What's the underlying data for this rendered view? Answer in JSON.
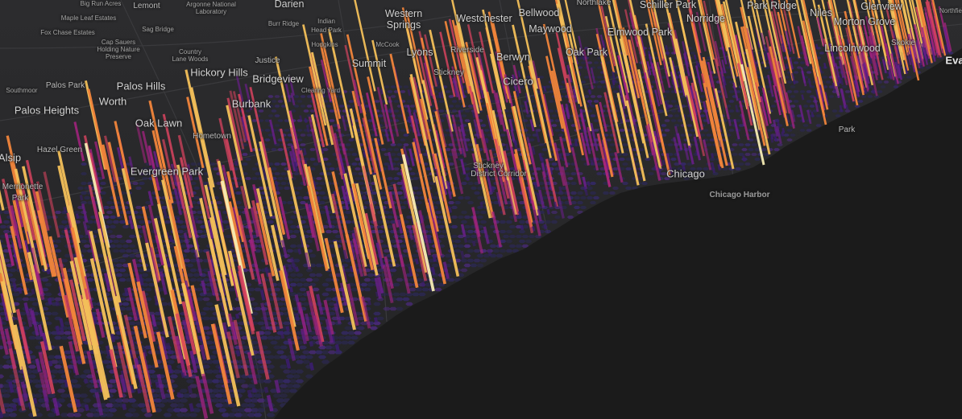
{
  "map": {
    "colors": {
      "land": "#2a2a2c",
      "lake": "#1b1b1b",
      "hex_base": "#2b2850",
      "column_ramp": [
        "#3b1d6e",
        "#6a1f8a",
        "#a3237f",
        "#d8435f",
        "#f2853b",
        "#f4c05a",
        "#f6ecb4"
      ]
    },
    "labels": [
      {
        "text": "Big Run Acres",
        "size": "small"
      },
      {
        "text": "Lemont",
        "size": "med"
      },
      {
        "text": "Argonne National",
        "size": "small"
      },
      {
        "text": "Laboratory",
        "size": "small"
      },
      {
        "text": "Darien",
        "size": "large"
      },
      {
        "text": "Western",
        "size": "large"
      },
      {
        "text": "Springs",
        "size": "large"
      },
      {
        "text": "Westchester",
        "size": "large"
      },
      {
        "text": "Bellwood",
        "size": "large"
      },
      {
        "text": "Northlake",
        "size": "med"
      },
      {
        "text": "Schiller Park",
        "size": "large"
      },
      {
        "text": "Park Ridge",
        "size": "large"
      },
      {
        "text": "Niles",
        "size": "large"
      },
      {
        "text": "Glenview",
        "size": "large"
      },
      {
        "text": "Northfie",
        "size": "small"
      },
      {
        "text": "Maple Leaf Estates",
        "size": "small"
      },
      {
        "text": "Burr Ridge",
        "size": "small"
      },
      {
        "text": "Indian",
        "size": "small"
      },
      {
        "text": "Head Park",
        "size": "small"
      },
      {
        "text": "Maywood",
        "size": "large"
      },
      {
        "text": "Elmwood Park",
        "size": "large"
      },
      {
        "text": "Norridge",
        "size": "large"
      },
      {
        "text": "Morton Grove",
        "size": "large"
      },
      {
        "text": "Fox Chase Estates",
        "size": "small"
      },
      {
        "text": "Sag Bridge",
        "size": "small"
      },
      {
        "text": "Hodgkins",
        "size": "small"
      },
      {
        "text": "McCook",
        "size": "small"
      },
      {
        "text": "Cap Sauers",
        "size": "small"
      },
      {
        "text": "Holding Nature",
        "size": "small"
      },
      {
        "text": "Preserve",
        "size": "small"
      },
      {
        "text": "Country",
        "size": "small"
      },
      {
        "text": "Lane Woods",
        "size": "small"
      },
      {
        "text": "Lyons",
        "size": "large"
      },
      {
        "text": "Riverside",
        "size": "med"
      },
      {
        "text": "Berwyn",
        "size": "large"
      },
      {
        "text": "Oak Park",
        "size": "large"
      },
      {
        "text": "Lincolnwood",
        "size": "large"
      },
      {
        "text": "Skokie",
        "size": "med"
      },
      {
        "text": "Eva",
        "size": "bright"
      },
      {
        "text": "Justice",
        "size": "med"
      },
      {
        "text": "Summit",
        "size": "large"
      },
      {
        "text": "Hickory Hills",
        "size": "xl"
      },
      {
        "text": "Stickney",
        "size": "med"
      },
      {
        "text": "Cicero",
        "size": "xl"
      },
      {
        "text": "Palos Park",
        "size": "med"
      },
      {
        "text": "Palos Hills",
        "size": "xl"
      },
      {
        "text": "Bridgeview",
        "size": "xl"
      },
      {
        "text": "Southmoor",
        "size": "small"
      },
      {
        "text": "Clearing Yard",
        "size": "small"
      },
      {
        "text": "Palos Heights",
        "size": "xl"
      },
      {
        "text": "Worth",
        "size": "xl"
      },
      {
        "text": "Burbank",
        "size": "xl"
      },
      {
        "text": "Oak Lawn",
        "size": "xl"
      },
      {
        "text": "Hometown",
        "size": "med"
      },
      {
        "text": "Park",
        "size": "med"
      },
      {
        "text": "Hazel Green",
        "size": "med"
      },
      {
        "text": "Alsip",
        "size": "xl"
      },
      {
        "text": "Evergreen Park",
        "size": "xl"
      },
      {
        "text": "Stickney",
        "size": "med"
      },
      {
        "text": "District Corridor",
        "size": "med"
      },
      {
        "text": "Chicago",
        "size": "xl"
      },
      {
        "text": "Chicago Harbor",
        "size": "water"
      },
      {
        "text": "Merrionette",
        "size": "med"
      },
      {
        "text": "Park",
        "size": "med"
      }
    ]
  }
}
